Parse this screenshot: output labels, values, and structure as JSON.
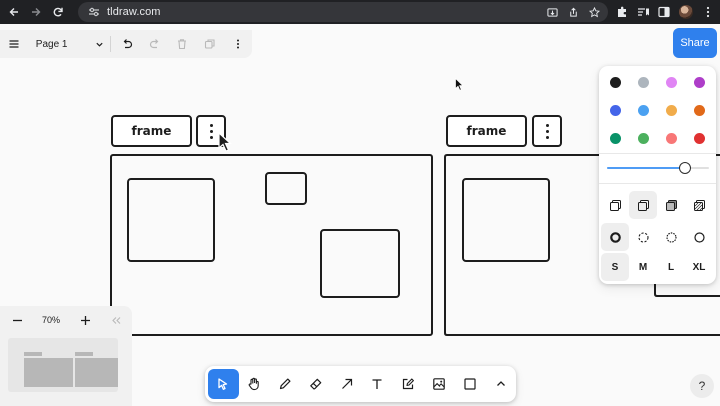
{
  "browser": {
    "url": "tldraw.com"
  },
  "menu_panel": {
    "page_name": "Page 1"
  },
  "share": {
    "label": "Share"
  },
  "frames": [
    {
      "label": "frame"
    },
    {
      "label": "frame"
    }
  ],
  "style_panel": {
    "colors": [
      {
        "name": "black",
        "hex": "#1d1d1d",
        "selected": true
      },
      {
        "name": "grey",
        "hex": "#adb5bd"
      },
      {
        "name": "light-violet",
        "hex": "#e085f4"
      },
      {
        "name": "violet",
        "hex": "#ae3ec9"
      },
      {
        "name": "blue",
        "hex": "#4465e9"
      },
      {
        "name": "light-blue",
        "hex": "#4ba1f1"
      },
      {
        "name": "yellow",
        "hex": "#f1ac4b"
      },
      {
        "name": "orange",
        "hex": "#e16919"
      },
      {
        "name": "green",
        "hex": "#099268"
      },
      {
        "name": "light-green",
        "hex": "#4cb05e"
      },
      {
        "name": "light-red",
        "hex": "#f87777"
      },
      {
        "name": "red",
        "hex": "#e03131"
      }
    ],
    "opacity": 0.8,
    "fill_options": [
      "fill-none-icon",
      "fill-semi-icon",
      "fill-solid-icon",
      "fill-pattern-icon"
    ],
    "fill_selected": 1,
    "dash_options": [
      "dash-draw-icon",
      "dash-dashed-icon",
      "dash-dotted-icon",
      "dash-solid-icon"
    ],
    "dash_selected": 0,
    "sizes": [
      "S",
      "M",
      "L",
      "XL"
    ],
    "size_selected": 0
  },
  "zoom": {
    "label": "70%"
  },
  "toolbar": {
    "tools": [
      "select-tool-icon",
      "hand-tool-icon",
      "draw-tool-icon",
      "eraser-tool-icon",
      "arrow-tool-icon",
      "text-tool-icon",
      "note-tool-icon",
      "media-tool-icon",
      "rectangle-tool-icon",
      "more-tools-chevron-icon"
    ],
    "active_tool": 0
  },
  "help": {
    "label": "?"
  },
  "colors": {
    "accent": "#2f80ed",
    "canvas": "#fafafa",
    "stroke": "#1d1d1d"
  }
}
